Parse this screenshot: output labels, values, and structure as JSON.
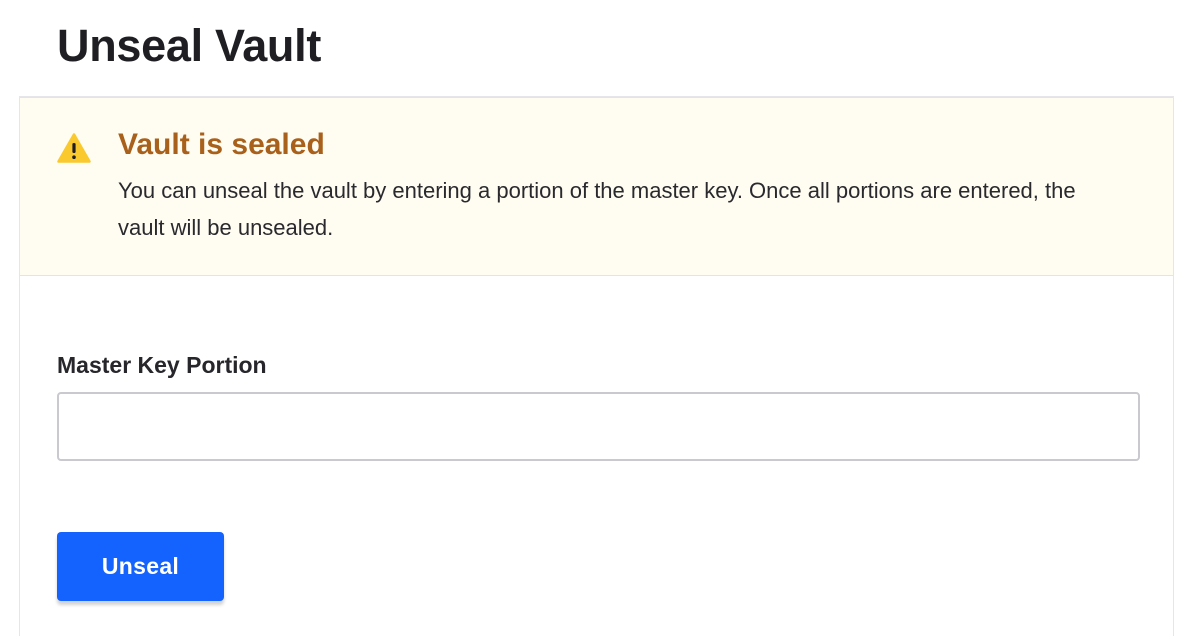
{
  "page": {
    "title": "Unseal Vault"
  },
  "alert": {
    "icon": "warning-triangle-icon",
    "title": "Vault is sealed",
    "message": "You can unseal the vault by entering a portion of the master key. Once all portions are entered, the vault will be unsealed."
  },
  "form": {
    "key_label": "Master Key Portion",
    "key_value": "",
    "key_placeholder": "",
    "submit_label": "Unseal"
  },
  "colors": {
    "primary_button": "#1563ff",
    "alert_title": "#a8601b",
    "alert_background": "#fffcf1",
    "warning_icon": "#fac92e"
  }
}
